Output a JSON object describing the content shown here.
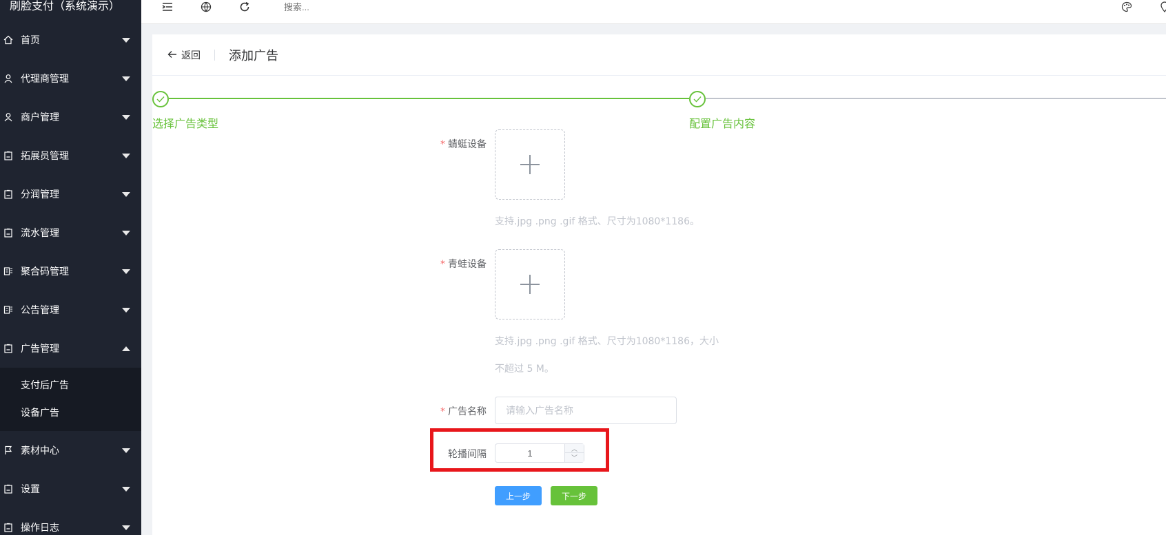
{
  "app": {
    "title": "刷脸支付（系统演示）"
  },
  "sidebar": {
    "items": [
      {
        "label": "首页",
        "icon": "home-icon"
      },
      {
        "label": "代理商管理",
        "icon": "user-icon"
      },
      {
        "label": "商户管理",
        "icon": "user-icon"
      },
      {
        "label": "拓展员管理",
        "icon": "clipboard-icon"
      },
      {
        "label": "分润管理",
        "icon": "clipboard-icon"
      },
      {
        "label": "流水管理",
        "icon": "clipboard-icon"
      },
      {
        "label": "聚合码管理",
        "icon": "document-icon"
      },
      {
        "label": "公告管理",
        "icon": "document-icon"
      },
      {
        "label": "广告管理",
        "icon": "clipboard-icon",
        "expanded": true
      },
      {
        "label": "素材中心",
        "icon": "flag-icon"
      },
      {
        "label": "设置",
        "icon": "clipboard-icon"
      },
      {
        "label": "操作日志",
        "icon": "clipboard-icon"
      }
    ],
    "submenu": [
      "支付后广告",
      "设备广告"
    ]
  },
  "topbar": {
    "search_placeholder": "搜索..."
  },
  "page": {
    "back_label": "返回",
    "title": "添加广告"
  },
  "steps": [
    {
      "title": "选择广告类型",
      "status": "finished"
    },
    {
      "title": "配置广告内容",
      "status": "finished"
    }
  ],
  "form": {
    "dragonfly": {
      "label": "蜻蜓设备",
      "required": "*",
      "hint": "支持.jpg .png .gif 格式、尺寸为1080*1186。"
    },
    "frog": {
      "label": "青蛙设备",
      "required": "*",
      "hint_line1": "支持.jpg .png .gif 格式、尺寸为1080*1186，大小",
      "hint_line2": "不超过 5 M。"
    },
    "ad_name": {
      "label": "广告名称",
      "required": "*",
      "placeholder": "请输入广告名称",
      "value": ""
    },
    "interval": {
      "label": "轮播间隔",
      "value": "1"
    },
    "prev_label": "上一步",
    "next_label": "下一步"
  },
  "colors": {
    "sidebar_bg": "#1f2430",
    "step_green": "#67c23a",
    "primary_blue": "#409eff",
    "highlight_red": "#e8161b"
  }
}
